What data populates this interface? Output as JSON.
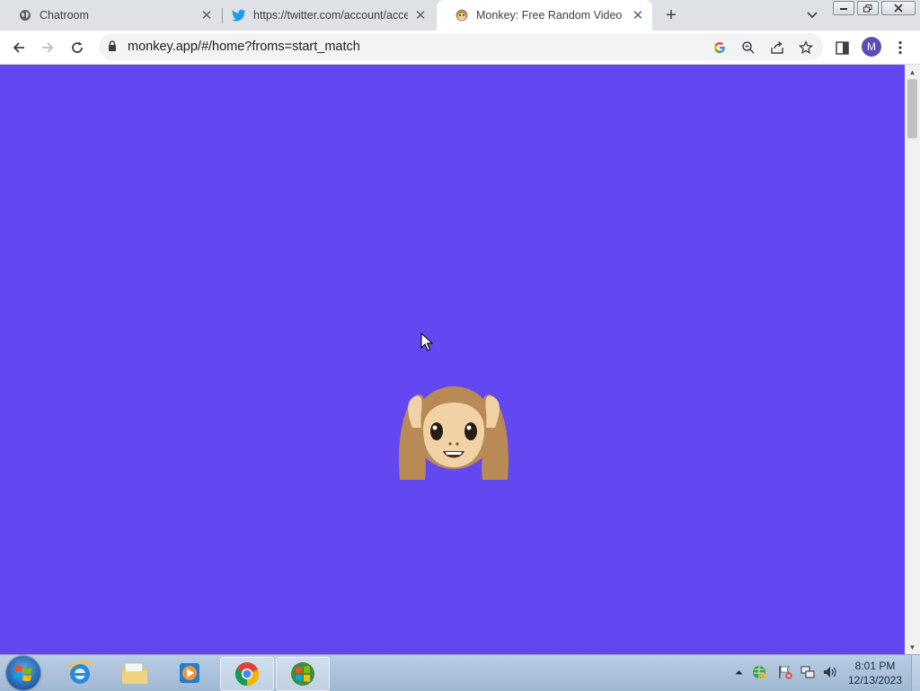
{
  "browser": {
    "tabs": [
      {
        "title": "Chatroom",
        "favicon": "globe-icon",
        "active": false
      },
      {
        "title": "https://twitter.com/account/acce",
        "favicon": "twitter-bird-icon",
        "active": false
      },
      {
        "title": "Monkey: Free Random Video Cha",
        "favicon": "monkey-icon",
        "active": true
      }
    ],
    "address_bar": {
      "url": "monkey.app/#/home?froms=start_match"
    },
    "profile_initial": "M"
  },
  "page": {
    "background_color": "#6347f0",
    "center_emoji": "hear-no-evil-monkey-icon"
  },
  "taskbar": {
    "apps": [
      "internet-explorer-icon",
      "file-explorer-icon",
      "media-player-icon",
      "chrome-icon",
      "windows-app-icon"
    ],
    "clock": {
      "time": "8:01 PM",
      "date": "12/13/2023"
    }
  }
}
